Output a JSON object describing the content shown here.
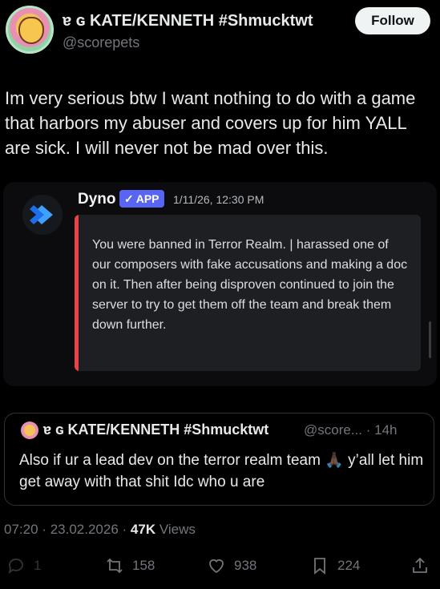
{
  "author": {
    "display_name": "ɐ ɢ KATE/KENNETH #Shmucktwt",
    "handle": "@scorepets"
  },
  "follow_label": "Follow",
  "tweet_text": "Im very serious btw I want nothing to do with a game that harbors my abuser and covers up for him YALL are sick. I will never not be mad over this.",
  "media": {
    "bot_name": "Dyno",
    "badge": "APP",
    "timestamp": "1/11/26, 12:30 PM",
    "embed_text": "You were banned in Terror Realm. | harassed one of our composers with fake accusations and making a doc on it. Then after being disproven continued to join the server to try to get them off the team and break them down further.",
    "accent_color": "#ed4245",
    "badge_color": "#5865f2"
  },
  "quoted": {
    "display_name": "ɐ ɢ KATE/KENNETH #Shmucktwt",
    "handle": "@score...",
    "age": "· 14h",
    "text": "Also if ur a lead dev on the terror realm team 🙏🏿 y’all let him get away with that shit  Idc who u are"
  },
  "meta": {
    "time": "07:20",
    "date": "23.02.2026",
    "views_count": "47K",
    "views_label": "Views"
  },
  "actions": {
    "replies": "1",
    "reposts": "158",
    "likes": "938",
    "bookmarks": "224"
  }
}
